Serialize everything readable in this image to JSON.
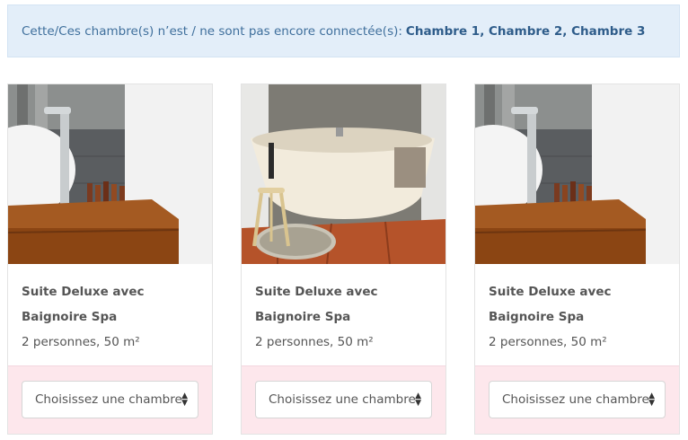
{
  "alert": {
    "text": "Cette/Ces chambre(s) n’est / ne sont pas encore connectée(s):",
    "rooms": "Chambre 1, Chambre 2, Chambre 3"
  },
  "cards": [
    {
      "title": "Suite Deluxe avec Baignoire Spa",
      "info": "2 personnes, 50 m²",
      "select_value": "Choisissez une chambre",
      "image": "sink-photo"
    },
    {
      "title": "Suite Deluxe avec Baignoire Spa",
      "info": "2 personnes, 50 m²",
      "select_value": "Choisissez une chambre",
      "image": "bathtub-photo"
    },
    {
      "title": "Suite Deluxe avec Baignoire Spa",
      "info": "2 personnes, 50 m²",
      "select_value": "Choisissez une chambre",
      "image": "sink-photo"
    }
  ],
  "icons": {
    "select_arrow": "up-down-arrows-icon"
  },
  "colors": {
    "alert_bg": "#e3eef9",
    "alert_text": "#3f6f9c",
    "footer_bg": "#fde7ec"
  }
}
